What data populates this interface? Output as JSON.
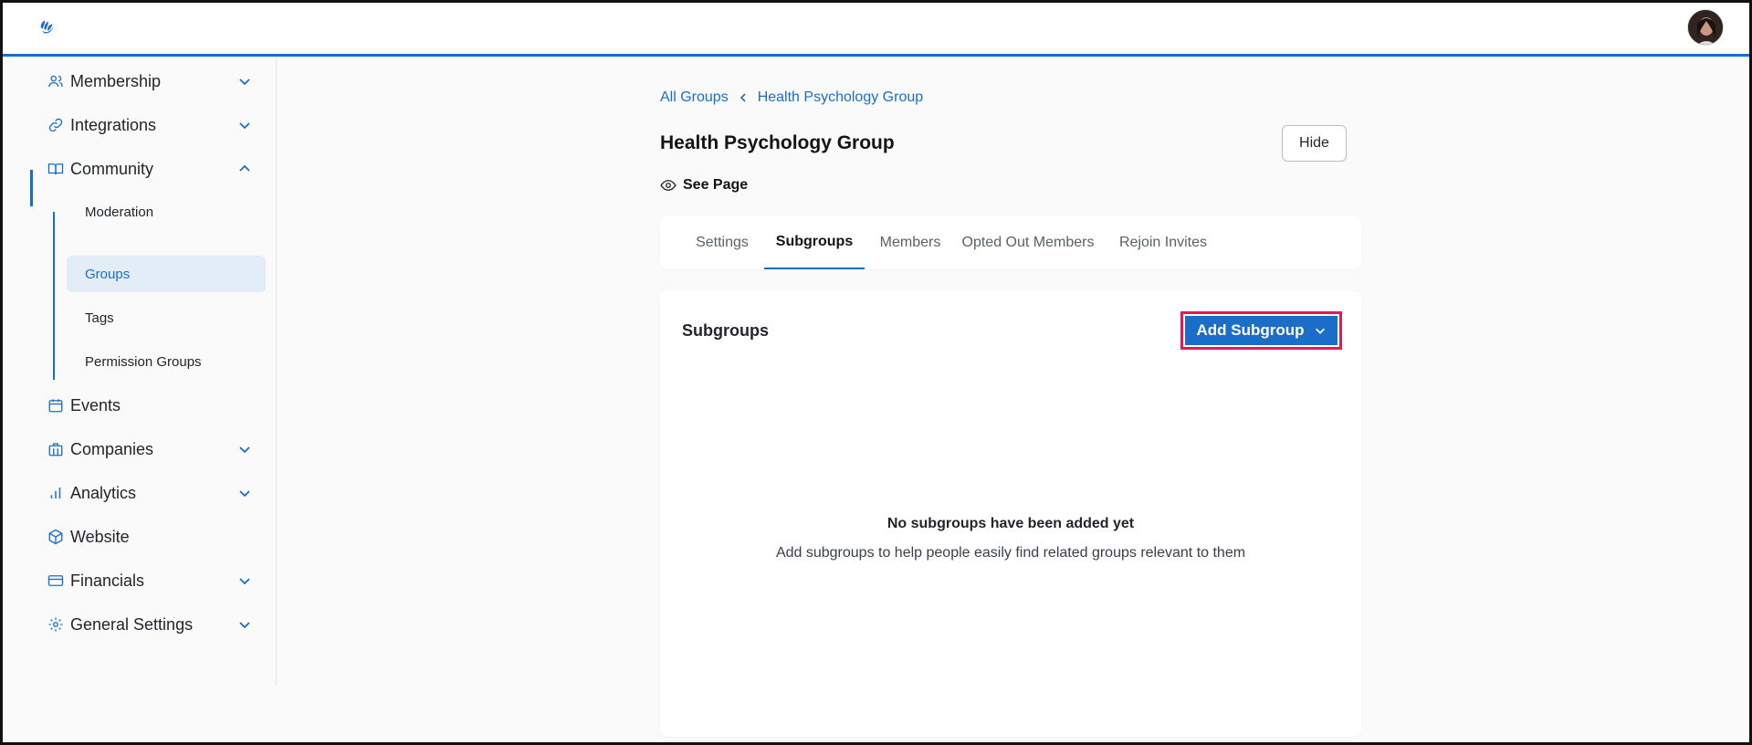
{
  "sidebar": {
    "items": [
      {
        "label": "Membership"
      },
      {
        "label": "Integrations"
      },
      {
        "label": "Community"
      },
      {
        "label": "Events"
      },
      {
        "label": "Companies"
      },
      {
        "label": "Analytics"
      },
      {
        "label": "Website"
      },
      {
        "label": "Financials"
      },
      {
        "label": "General Settings"
      }
    ],
    "community_sub": [
      {
        "label": "Moderation"
      },
      {
        "label": "Groups"
      },
      {
        "label": "Tags"
      },
      {
        "label": "Permission Groups"
      }
    ]
  },
  "breadcrumb": {
    "root": "All Groups",
    "current": "Health Psychology Group"
  },
  "page": {
    "title": "Health Psychology Group",
    "hide_label": "Hide",
    "see_page_label": "See Page"
  },
  "tabs": [
    {
      "label": "Settings"
    },
    {
      "label": "Subgroups"
    },
    {
      "label": "Members"
    },
    {
      "label": "Opted Out Members"
    },
    {
      "label": "Rejoin Invites"
    }
  ],
  "subgroups": {
    "title": "Subgroups",
    "add_label": "Add Subgroup",
    "empty_title": "No subgroups have been added yet",
    "empty_desc": "Add subgroups to help people easily find related groups relevant to them"
  },
  "colors": {
    "accent": "#1b6ec8",
    "highlight": "#e3195c"
  }
}
